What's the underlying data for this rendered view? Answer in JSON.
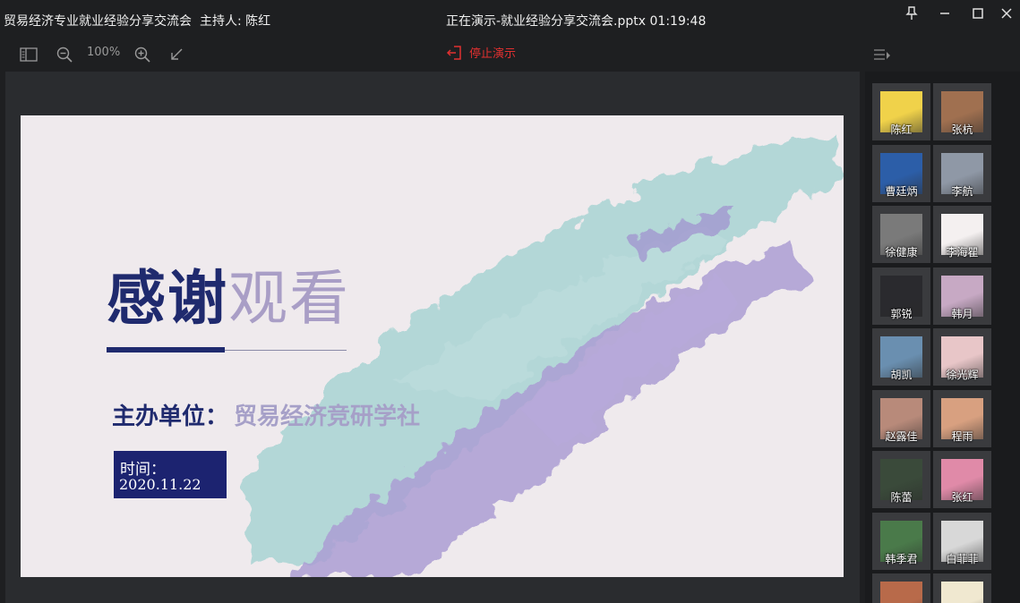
{
  "window": {
    "meeting_title": "贸易经济专业就业经验分享交流会",
    "host_label": "主持人: 陈红",
    "presenting_status": "正在演示-就业经验分享交流会.pptx 01:19:48"
  },
  "toolbar": {
    "zoom_level": "100%",
    "stop_presenting_label": "停止演示"
  },
  "slide": {
    "heading_strong": "感谢",
    "heading_light": "观看",
    "organizer_label": "主办单位：",
    "organizer_name": "贸易经济竞研学社",
    "date_label": "时间：",
    "date_value": "2020.11.22"
  },
  "participants": [
    {
      "name": "陈红",
      "color": "#f0d24a"
    },
    {
      "name": "张杭",
      "color": "#a07050"
    },
    {
      "name": "曹廷炳",
      "color": "#2c5ea8"
    },
    {
      "name": "李航",
      "color": "#8f98a6"
    },
    {
      "name": "徐健康",
      "color": "#7a7a7a"
    },
    {
      "name": "李海瞿",
      "color": "#f4f0f0"
    },
    {
      "name": "郭锐",
      "color": "#2a2a2e"
    },
    {
      "name": "韩月",
      "color": "#c7a9c4"
    },
    {
      "name": "胡凯",
      "color": "#6a8fb0"
    },
    {
      "name": "徐光辉",
      "color": "#e8c6c8"
    },
    {
      "name": "赵露佳",
      "color": "#b88a7a"
    },
    {
      "name": "程雨",
      "color": "#d8a080"
    },
    {
      "name": "陈蕾",
      "color": "#3a4a3a"
    },
    {
      "name": "张红",
      "color": "#e08aa8"
    },
    {
      "name": "韩季君",
      "color": "#4a7a4a"
    },
    {
      "name": "白菲菲",
      "color": "#d8d8d8"
    },
    {
      "name": "",
      "color": "#b86a4a"
    },
    {
      "name": "",
      "color": "#f0e8d0"
    }
  ]
}
